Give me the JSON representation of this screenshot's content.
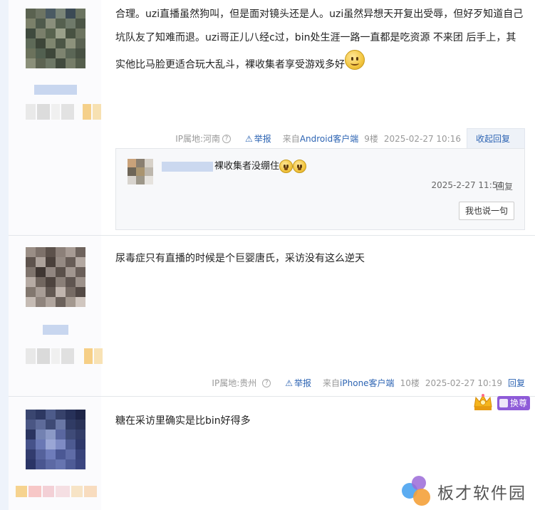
{
  "posts": [
    {
      "content_line1": "合理。uzi直播虽然狗叫，但是面对镜头还是人。uzi虽然异想天开复出受辱，但好歹知道自己",
      "content_line2": "坑队友了知难而退。uzi哥正儿八经c过，bin处生涯一路一直都是吃资源 不来团 后手上，其",
      "content_line3": "实他比马脸更适合玩大乱斗，裸收集者享受游戏多好",
      "ip_label": "IP属地:河南",
      "report": "举报",
      "source_prefix": "来自",
      "source_link": "Android客户端",
      "floor": "9楼",
      "time": "2025-02-27 10:16",
      "reply_tab": "收起回复",
      "sub_reply": {
        "text": "裸收集者没绷住",
        "time": "2025-2-27 11:54",
        "reply": "回复",
        "say_button": "我也说一句"
      }
    },
    {
      "content_line1": "尿毒症只有直播的时候是个巨婴唐氏，采访没有这么逆天",
      "ip_label": "IP属地:贵州",
      "report": "举报",
      "source_prefix": "来自",
      "source_link": "iPhone客户端",
      "floor": "10楼",
      "time": "2025-02-27 10:19",
      "reply": "回复"
    },
    {
      "content_line1": "糖在采访里确实是比bin好得多",
      "badge": "换尊"
    }
  ],
  "watermark": "板才软件园",
  "icons": [
    "question-icon",
    "warning-icon",
    "smile-emoji",
    "shock-emoji",
    "crown-icon"
  ]
}
